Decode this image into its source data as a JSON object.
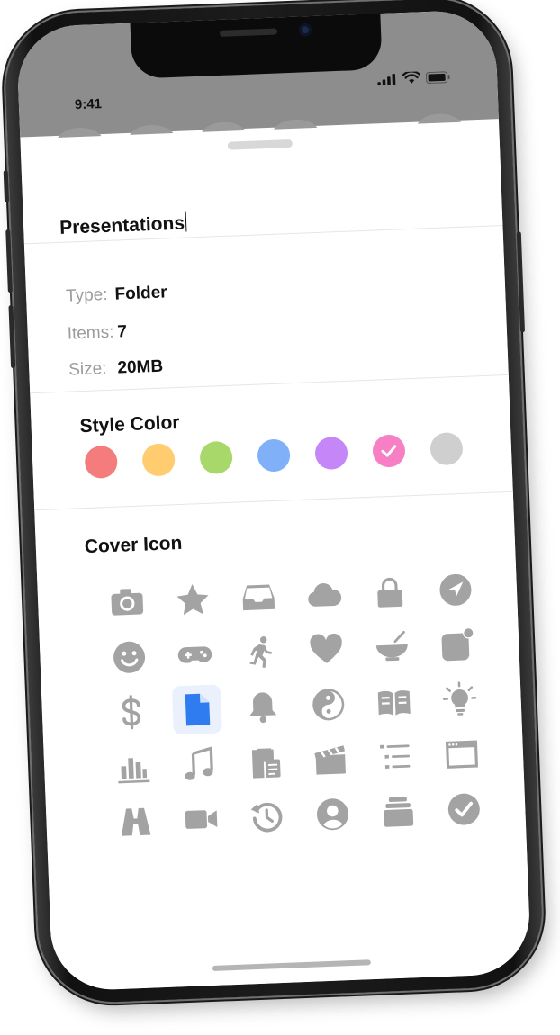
{
  "status": {
    "time": "9:41",
    "icons": [
      "signal-icon",
      "wifi-icon",
      "battery-icon"
    ]
  },
  "sheet": {
    "name_value": "Presentations",
    "info": [
      {
        "label": "Type:",
        "value": "Folder"
      },
      {
        "label": "Items:",
        "value": "7"
      },
      {
        "label": "Size:",
        "value": "20MB"
      }
    ],
    "style_color_title": "Style Color",
    "colors": [
      "#f47c7c",
      "#ffcc6f",
      "#a8d86a",
      "#7fb0f8",
      "#c586f7",
      "#f77fc4",
      "#cfcfcf"
    ],
    "selected_color": "#f77fc4",
    "cover_icon_title": "Cover Icon",
    "icons": [
      "camera-icon",
      "star-icon",
      "inbox-tray-icon",
      "cloud-icon",
      "lock-icon",
      "location-arrow-icon",
      "smiley-icon",
      "gamepad-icon",
      "running-person-icon",
      "heart-icon",
      "bowl-icon",
      "notification-badge-icon",
      "dollar-icon",
      "document-icon",
      "bell-icon",
      "yin-yang-icon",
      "open-book-icon",
      "lightbulb-icon",
      "bar-chart-icon",
      "music-note-icon",
      "clipboard-icon",
      "clapperboard-icon",
      "checklist-icon",
      "browser-window-icon",
      "binoculars-icon",
      "video-camera-icon",
      "history-icon",
      "user-circle-icon",
      "stack-icon",
      "checkmark-circle-icon"
    ],
    "selected_icon": "document-icon",
    "icon_color": "#a3a3a3",
    "accent_color": "#2f7bf0"
  }
}
